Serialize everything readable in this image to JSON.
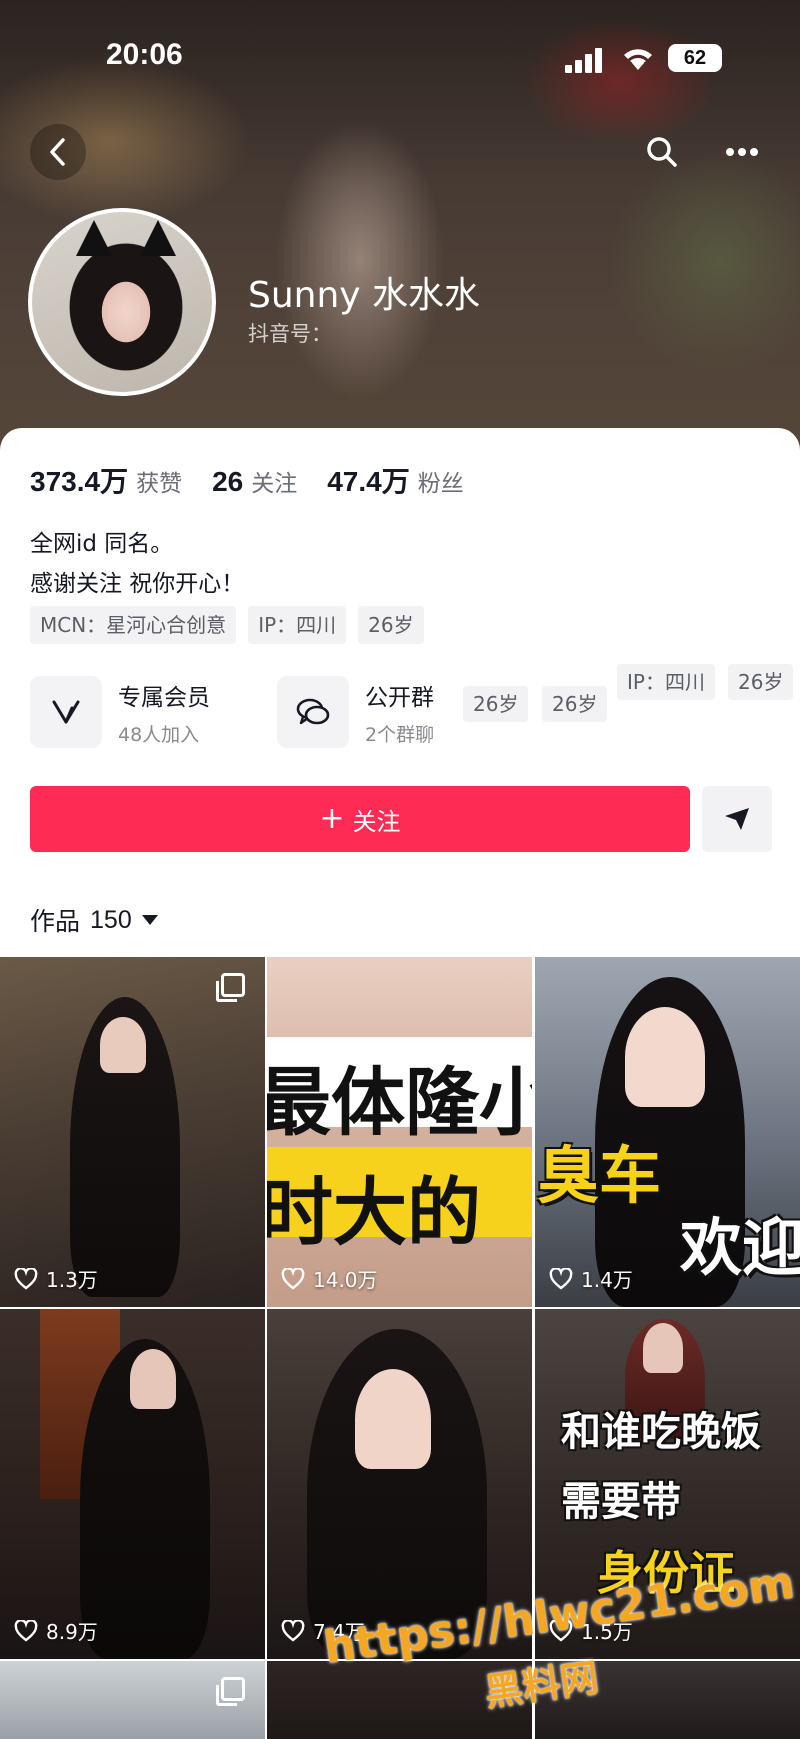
{
  "status_bar": {
    "time": "20:06",
    "battery": "62"
  },
  "profile": {
    "name": "Sunny 水水水",
    "id_label": "抖音号：",
    "stats": [
      {
        "value": "373.4万",
        "label": "获赞"
      },
      {
        "value": "26",
        "label": "关注"
      },
      {
        "value": "47.4万",
        "label": "粉丝"
      }
    ],
    "bio_lines": [
      "全网id 同名。",
      "感谢关注 祝你开心！"
    ],
    "tags": [
      "MCN：星河心合创意",
      "IP：四川",
      "26岁"
    ]
  },
  "features": {
    "members": {
      "title": "专属会员",
      "subtitle": "48人加入"
    },
    "group": {
      "title": "公开群",
      "subtitle": "2个群聊"
    }
  },
  "extra_tags": [
    "26岁",
    "26岁",
    "IP：四川",
    "26岁"
  ],
  "actions": {
    "follow_label": "关注"
  },
  "works": {
    "label": "作品",
    "count": "150"
  },
  "tiles": [
    {
      "likes": "1.3万",
      "overlay": ""
    },
    {
      "likes": "14.0万",
      "overlay_line1": "最体隆小",
      "overlay_line2": "时大的"
    },
    {
      "likes": "1.4万",
      "overlay_line1": "臭车",
      "overlay_line2": "欢迎"
    },
    {
      "likes": "8.9万",
      "overlay": ""
    },
    {
      "likes": "7.4万",
      "overlay": ""
    },
    {
      "likes": "1.5万",
      "overlay_line1": "和谁吃晚饭",
      "overlay_line2": "需要带",
      "overlay_line3": "身份证"
    }
  ],
  "watermark": {
    "url": "https://hlwc21.com",
    "name": "黑料网"
  },
  "colors": {
    "accent": "#fe2c55",
    "watermark": "#f5a623"
  },
  "icons": [
    "back-icon",
    "search-icon",
    "more-icon",
    "member-v-icon",
    "group-chat-icon",
    "share-arrow-icon",
    "heart-icon",
    "multi-image-icon"
  ]
}
